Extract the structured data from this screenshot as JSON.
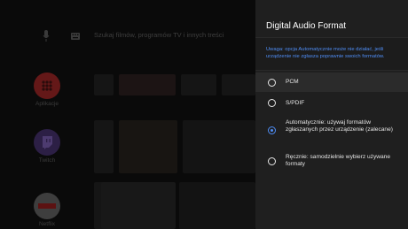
{
  "home": {
    "search_placeholder": "Szukaj filmów, programów TV i innych treści",
    "apps": [
      {
        "label": "Aplikacje",
        "color": "#7a1e1e"
      },
      {
        "label": "Twitch",
        "color": "#3d2a5c"
      },
      {
        "label": "Netflix",
        "color": "#5c1212"
      }
    ]
  },
  "panel": {
    "title": "Digital Audio Format",
    "notice": "Uwaga: opcja Automatycznie może nie działać, jeśli urządzenie nie zgłasza poprawnie swoich formatów.",
    "options": [
      {
        "label": "PCM",
        "checked": false
      },
      {
        "label": "S/PDIF",
        "checked": false
      },
      {
        "label": "Automatycznie: używaj formatów zgłaszanych przez urządzenie (zalecane)",
        "checked": true
      },
      {
        "label": "Ręcznie: samodzielnie wybierz używane formaty",
        "checked": false
      }
    ]
  },
  "colors": {
    "accent": "#4f8df5",
    "panel_bg": "#1f1f1f"
  }
}
